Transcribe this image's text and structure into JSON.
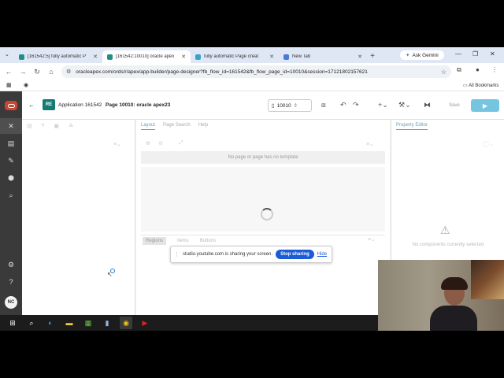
{
  "browser": {
    "tabs": [
      {
        "title": "[161542:5] fully automatic P",
        "fav_color": "#1f8f8a",
        "active": false
      },
      {
        "title": "[161542:10010] oracle apex",
        "fav_color": "#1f8f8a",
        "active": true
      },
      {
        "title": "fully automatic Page creat",
        "fav_color": "#3aa2c8",
        "active": false
      },
      {
        "title": "New Tab",
        "fav_color": "#4a79d8",
        "active": false
      }
    ],
    "ask_gemini": "Ask Gemini",
    "url": "oracleapex.com/ords/r/apex/app-builder/page-designer?fb_flow_id=161542&fb_flow_page_id=10010&session=17121802157621",
    "bookmarks": "All Bookmarks"
  },
  "apex": {
    "app_badge": "RE",
    "app_label": "Application 161542",
    "page_label": "Page 10010: oracle apex23",
    "page_number": "10010",
    "save_label": "Save",
    "user_initials": "NC",
    "mid_tabs": [
      "Layout",
      "Page Search",
      "Help"
    ],
    "no_template_msg": "No page or page has no template",
    "bottom_tabs": [
      "Regions",
      "Items",
      "Buttons"
    ],
    "right_tab": "Property Editor",
    "no_components": "No components currently selected"
  },
  "share": {
    "message": "studio.youtube.com is sharing your screen.",
    "stop_label": "Stop sharing",
    "hide_label": "Hide"
  },
  "colors": {
    "accent": "#147a74",
    "run_button": "#75c5e0",
    "stop_sharing": "#1a5bd6"
  }
}
